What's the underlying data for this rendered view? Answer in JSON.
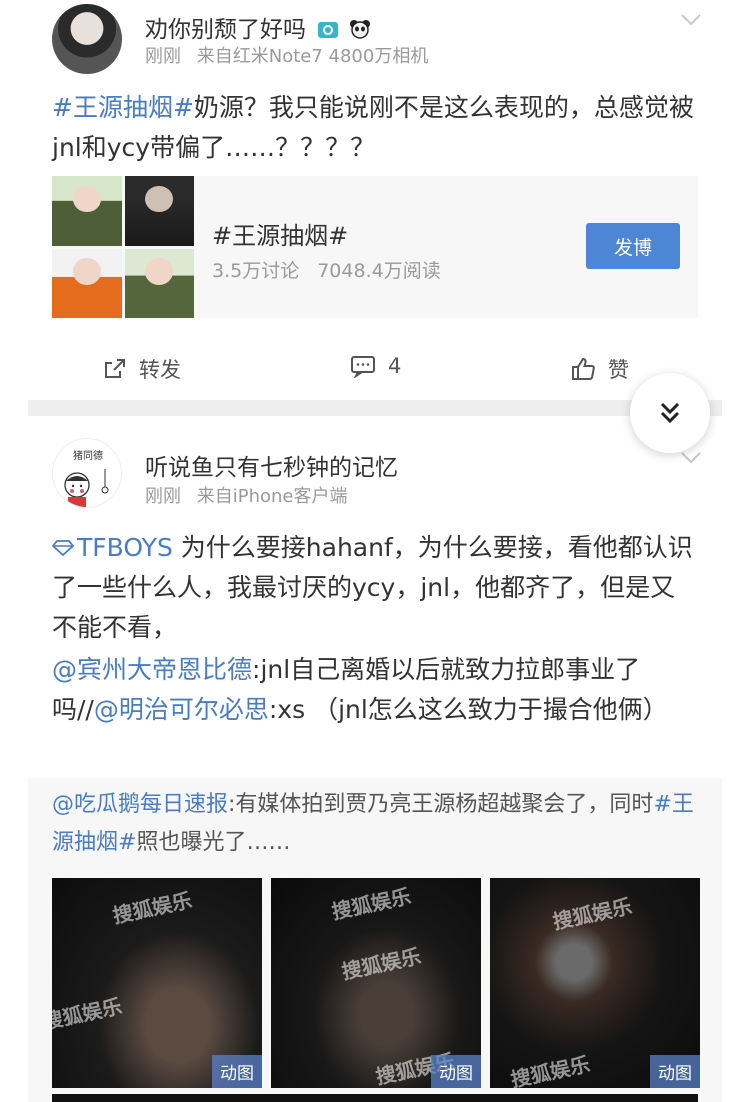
{
  "post1": {
    "username": "劝你别颓了好吗",
    "name_badges": [
      "camera-badge-icon",
      "panda-badge-icon"
    ],
    "time": "刚刚",
    "source": "来自红米Note7 4800万相机",
    "text_topic": "#王源抽烟#",
    "text_body": "奶源？我只能说刚不是这么表现的，总感觉被jnl和ycy带偏了……？？？？",
    "topic_card": {
      "title": "#王源抽烟#",
      "discussions": "3.5万讨论",
      "reads": "7048.4万阅读",
      "button_label": "发博"
    },
    "actions": {
      "repost_label": "转发",
      "comment_count": "4",
      "like_label": "赞"
    }
  },
  "post2": {
    "username": "听说鱼只有七秒钟的记忆",
    "avatar_text": "猪同德",
    "time": "刚刚",
    "source": "来自iPhone客户端",
    "supertopic": "TFBOYS",
    "text_body": " 为什么要接hahanf，为什么要接，看他都认识了一些什么人，我最讨厌的ycy，jnl，他都齐了，但是又不能不看，",
    "repost_chain": {
      "mention1": "@宾州大帝恩比德",
      "text1": ":jnl自己离婚以后就致力拉郎事业了吗//",
      "mention2": "@明治可尔必思",
      "text2": ":xs （jnl怎么这么致力于撮合他俩）"
    },
    "quoted": {
      "mention": "@吃瓜鹅每日速报",
      "text_before_topic": ":有媒体拍到贾乃亮王源杨超越聚会了，同时",
      "topic": "#王源抽烟#",
      "text_after_topic": "照也曝光了……",
      "photos": [
        {
          "watermark": "搜狐娱乐",
          "badge": "动图"
        },
        {
          "watermark": "搜狐娱乐",
          "badge": "动图"
        },
        {
          "watermark": "搜狐娱乐",
          "badge": "动图"
        }
      ]
    }
  },
  "floating_button": {
    "icon": "double-chevron-down-icon"
  }
}
